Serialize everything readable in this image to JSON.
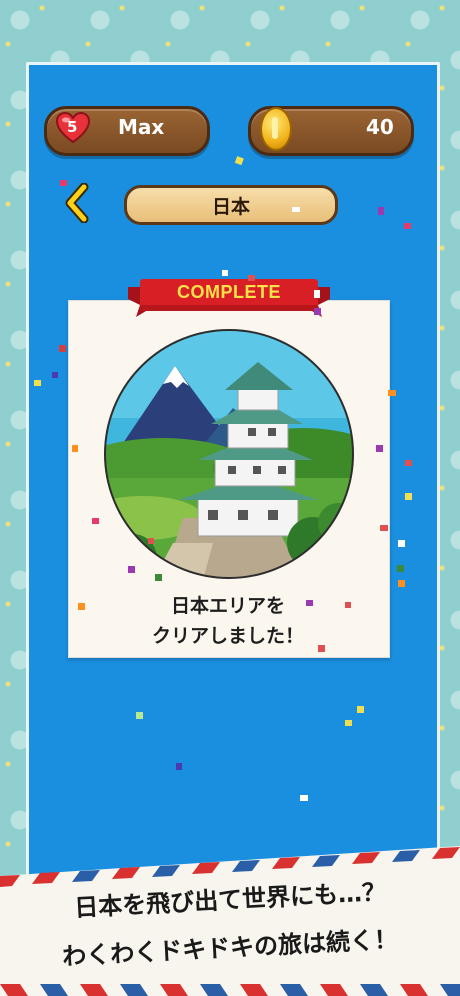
{
  "status_bar": {
    "lives": "5",
    "lives_label": "Max",
    "coins": "40"
  },
  "header": {
    "area_title": "日本"
  },
  "card": {
    "banner": "COMPLETE",
    "message_line1": "日本エリアを",
    "message_line2": "クリアしました！"
  },
  "promo": {
    "line1": "日本を飛び出て世界にも…？",
    "line2": "わくわくドキドキの旅は続く！"
  },
  "icons": [
    "heart-icon",
    "coin-icon",
    "back-arrow-icon",
    "castle-illustration"
  ],
  "colors": {
    "board_blue": "#1a8fe0",
    "ribbon_red": "#d81f26",
    "ribbon_text": "#ffe24a",
    "wood": "#8a5a2c",
    "background_teal": "#8fcfcf"
  }
}
